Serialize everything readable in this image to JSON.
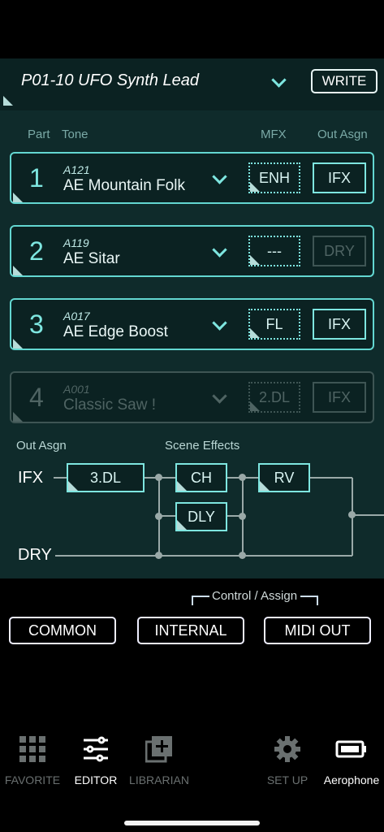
{
  "patch": {
    "name": "P01-10 UFO Synth Lead",
    "write_label": "WRITE"
  },
  "columns": {
    "part": "Part",
    "tone": "Tone",
    "mfx": "MFX",
    "out_asgn": "Out Asgn"
  },
  "parts": [
    {
      "num": "1",
      "code": "A121",
      "tone": "AE Mountain Folk",
      "mfx": "ENH",
      "out": "IFX",
      "active": true
    },
    {
      "num": "2",
      "code": "A119",
      "tone": "AE Sitar",
      "mfx": "---",
      "out": "DRY",
      "active": true
    },
    {
      "num": "3",
      "code": "A017",
      "tone": "AE Edge Boost",
      "mfx": "FL",
      "out": "IFX",
      "active": true
    },
    {
      "num": "4",
      "code": "A001",
      "tone": "Classic Saw !",
      "mfx": "2.DL",
      "out": "IFX",
      "active": false
    }
  ],
  "routing": {
    "out_asgn_label": "Out Asgn",
    "scene_effects_label": "Scene Effects",
    "ifx_label": "IFX",
    "dry_label": "DRY",
    "ifx_effect": "3.DL",
    "chorus": "CH",
    "delay": "DLY",
    "reverb": "RV"
  },
  "control_assign_label": "Control / Assign",
  "buttons": {
    "common": "COMMON",
    "internal": "INTERNAL",
    "midi_out": "MIDI OUT"
  },
  "nav": {
    "favorite": "FAVORITE",
    "editor": "EDITOR",
    "librarian": "LIBRARIAN",
    "setup": "SET UP",
    "device": "Aerophone"
  },
  "colors": {
    "accent": "#7ee6e0",
    "panel": "#0f2b2b",
    "inactive": "#3e5554"
  }
}
